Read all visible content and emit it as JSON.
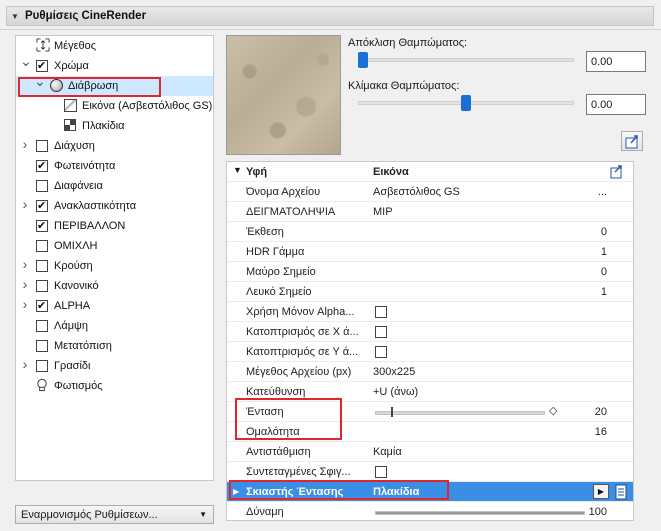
{
  "header": {
    "title": "Ρυθμίσεις CineRender"
  },
  "tree": [
    {
      "label": "Μέγεθος",
      "level": 0,
      "expander": "",
      "check": "icon-size",
      "checked": false
    },
    {
      "label": "Χρώμα",
      "level": 0,
      "expander": "v",
      "check": "box",
      "checked": true
    },
    {
      "label": "Διάβρωση",
      "level": 1,
      "expander": "v",
      "check": "sphere",
      "checked": false,
      "selected": true
    },
    {
      "label": "Εικόνα (Ασβεστόλιθος GS)",
      "level": 2,
      "expander": "",
      "check": "image",
      "checked": false
    },
    {
      "label": "Πλακίδια",
      "level": 2,
      "expander": "",
      "check": "tile",
      "checked": false
    },
    {
      "label": "Διάχυση",
      "level": 0,
      "expander": ">",
      "check": "box",
      "checked": false
    },
    {
      "label": "Φωτεινότητα",
      "level": 0,
      "expander": "",
      "check": "box",
      "checked": true
    },
    {
      "label": "Διαφάνεια",
      "level": 0,
      "expander": "",
      "check": "box",
      "checked": false
    },
    {
      "label": "Ανακλαστικότητα",
      "level": 0,
      "expander": ">",
      "check": "box",
      "checked": true
    },
    {
      "label": "ΠΕΡΙΒΑΛΛΟΝ",
      "level": 0,
      "expander": "",
      "check": "box",
      "checked": true
    },
    {
      "label": "ΟΜΙΧΛΗ",
      "level": 0,
      "expander": "",
      "check": "box",
      "checked": false
    },
    {
      "label": "Κρούση",
      "level": 0,
      "expander": ">",
      "check": "box",
      "checked": false
    },
    {
      "label": "Κανονικό",
      "level": 0,
      "expander": ">",
      "check": "box",
      "checked": false
    },
    {
      "label": "ALPHA",
      "level": 0,
      "expander": ">",
      "check": "box",
      "checked": true
    },
    {
      "label": "Λάμψη",
      "level": 0,
      "expander": "",
      "check": "box",
      "checked": false
    },
    {
      "label": "Μετατόπιση",
      "level": 0,
      "expander": "",
      "check": "box",
      "checked": false
    },
    {
      "label": "Γρασίδι",
      "level": 0,
      "expander": ">",
      "check": "box",
      "checked": false
    },
    {
      "label": "Φωτισμός",
      "level": 0,
      "expander": "",
      "check": "bulb",
      "checked": false
    }
  ],
  "sync_button": {
    "label": "Εναρμονισμός Ρυθμίσεων..."
  },
  "preview_controls": {
    "blur_offset_label": "Απόκλιση Θαμπώματος:",
    "blur_offset_value": "0.00",
    "blur_offset_level": 0.0,
    "blur_scale_label": "Κλίμακα Θαμπώματος:",
    "blur_scale_value": "0.00",
    "blur_scale_level": 0.5
  },
  "properties": {
    "header": {
      "key": "Υφή",
      "value": "Εικόνα"
    },
    "rows": [
      {
        "key": "Όνομα Αρχείου",
        "value": "Ασβεστόλιθος GS",
        "num": "...",
        "type": "text"
      },
      {
        "key": "ΔΕΙΓΜΑΤΟΛΗΨΙΑ",
        "value": "MIP",
        "num": "",
        "type": "text"
      },
      {
        "key": "Έκθεση",
        "value": "",
        "num": "0",
        "type": "text"
      },
      {
        "key": "HDR Γάμμα",
        "value": "",
        "num": "1",
        "type": "text"
      },
      {
        "key": "Μαύρο Σημείο",
        "value": "",
        "num": "0",
        "type": "text"
      },
      {
        "key": "Λευκό Σημείο",
        "value": "",
        "num": "1",
        "type": "text"
      },
      {
        "key": "Χρήση Μόνον Alpha...",
        "value": "",
        "num": "",
        "type": "check"
      },
      {
        "key": "Κατοπτρισμός σε Χ ά...",
        "value": "",
        "num": "",
        "type": "check"
      },
      {
        "key": "Κατοπτρισμός σε Υ ά...",
        "value": "",
        "num": "",
        "type": "check"
      },
      {
        "key": "Μέγεθος Αρχείου (px)",
        "value": "300x225",
        "num": "",
        "type": "text"
      },
      {
        "key": "Κατεύθυνση",
        "value": "+U (άνω)",
        "num": "",
        "type": "text"
      },
      {
        "key": "Ένταση",
        "value": "",
        "num": "20",
        "type": "slider"
      },
      {
        "key": "Ομαλότητα",
        "value": "",
        "num": "16",
        "type": "text"
      },
      {
        "key": "Αντιστάθμιση",
        "value": "Καμία",
        "num": "",
        "type": "text"
      },
      {
        "key": "Συντεταγμένες Σφιγ...",
        "value": "",
        "num": "",
        "type": "check"
      },
      {
        "key": "Σκιαστής Έντασης",
        "value": "Πλακίδια",
        "num": "",
        "type": "shader"
      },
      {
        "key": "Δύναμη",
        "value": "",
        "num": "100",
        "type": "bar"
      }
    ]
  }
}
